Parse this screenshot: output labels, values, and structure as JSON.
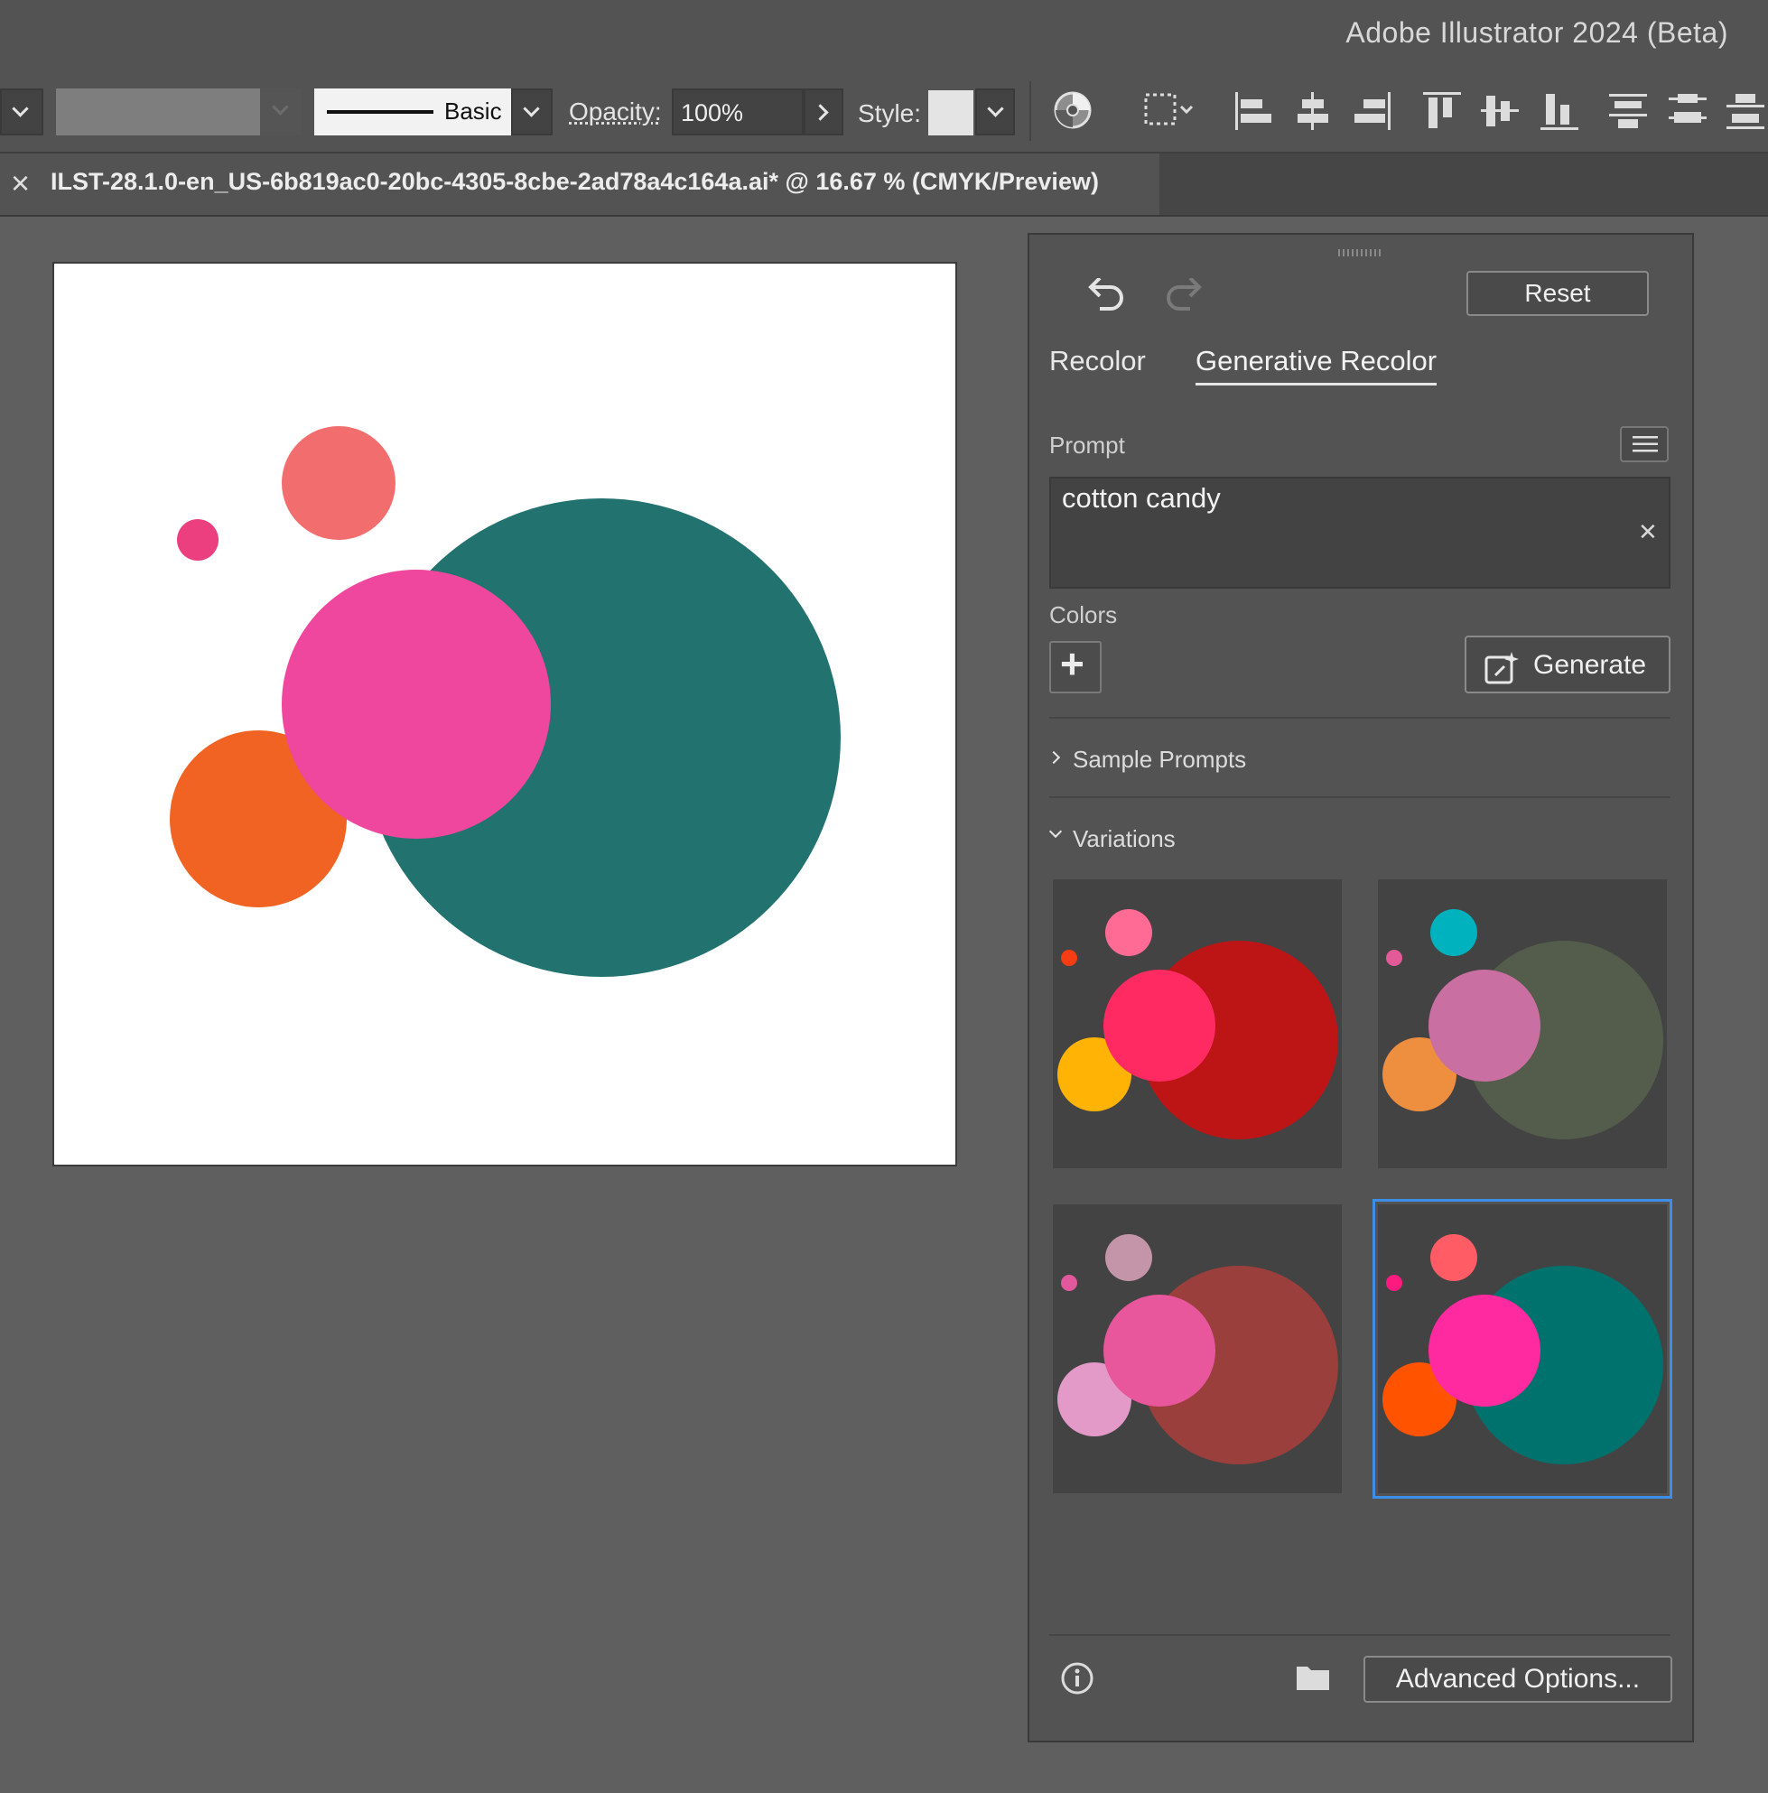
{
  "app": {
    "title": "Adobe Illustrator 2024 (Beta)"
  },
  "controlbar": {
    "stroke_profile": "Basic",
    "opacity_label": "Opacity:",
    "opacity_value": "100%",
    "style_label": "Style:"
  },
  "document_tab": {
    "close": "×",
    "title": "ILST-28.1.0-en_US-6b819ac0-20bc-4305-8cbe-2ad78a4c164a.ai* @ 16.67 % (CMYK/Preview)"
  },
  "artwork": {
    "colors": {
      "teal": "#227370",
      "pink": "#ee479d",
      "orange": "#f06322",
      "coral": "#f26e6e",
      "dot": "#ec3f80"
    }
  },
  "panel": {
    "reset_label": "Reset",
    "tabs": [
      {
        "label": "Recolor",
        "active": false
      },
      {
        "label": "Generative Recolor",
        "active": true
      }
    ],
    "prompt_label": "Prompt",
    "prompt_value": "cotton candy",
    "clear_glyph": "✕",
    "colors_label": "Colors",
    "add_color_glyph": "+",
    "generate_label": "Generate",
    "sample_prompts_label": "Sample Prompts",
    "variations_label": "Variations",
    "variations": [
      {
        "big": "#bd1515",
        "mid": "#ff2a62",
        "left": "#ffb405",
        "top": "#ff6b95",
        "dot": "#f53c12",
        "selected": false
      },
      {
        "big": "#545d4c",
        "mid": "#c96fa1",
        "left": "#ee8e3f",
        "top": "#00b2bd",
        "dot": "#e25a98",
        "selected": false
      },
      {
        "big": "#9a3f3b",
        "mid": "#e8569b",
        "left": "#e39ac9",
        "top": "#c495a9",
        "dot": "#e2589d",
        "selected": false
      },
      {
        "big": "#00726d",
        "mid": "#ff2aa0",
        "left": "#ff5300",
        "top": "#ff5c66",
        "dot": "#ff1a80",
        "selected": true
      }
    ],
    "advanced_label": "Advanced Options...",
    "selection_color": "#3d8ee8"
  }
}
